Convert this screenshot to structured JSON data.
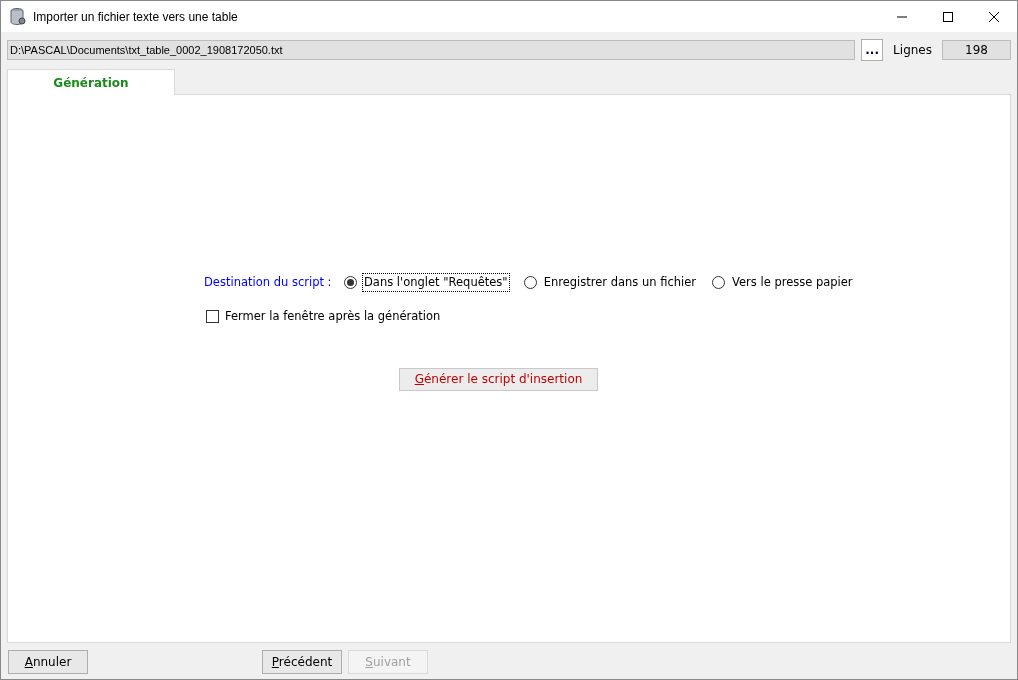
{
  "window": {
    "title": "Importer un fichier texte vers une table"
  },
  "file_path": {
    "value": "D:\\PASCAL\\Documents\\txt_table_0002_1908172050.txt"
  },
  "browse_button": "...",
  "lines": {
    "label": "Lignes",
    "value": "198"
  },
  "tabs": [
    {
      "label": "Génération",
      "selected": true
    }
  ],
  "destination": {
    "label": "Destination du script :",
    "options": [
      {
        "label": "Dans l'onglet \"Requêtes\"",
        "selected": true,
        "focused": true
      },
      {
        "label": "Enregistrer dans un fichier",
        "selected": false,
        "focused": false
      },
      {
        "label": "Vers le presse papier",
        "selected": false,
        "focused": false
      }
    ]
  },
  "close_after": {
    "label": "Fermer la fenêtre après la génération",
    "checked": false
  },
  "generate_button": {
    "label": "Générer le script d'insertion",
    "underline_first": true
  },
  "footer_buttons": [
    {
      "label": "Annuler",
      "underline_first": true,
      "disabled": false
    },
    {
      "label": "Précédent",
      "underline_first": true,
      "disabled": false
    },
    {
      "label": "Suivant",
      "underline_first": true,
      "disabled": true
    }
  ]
}
